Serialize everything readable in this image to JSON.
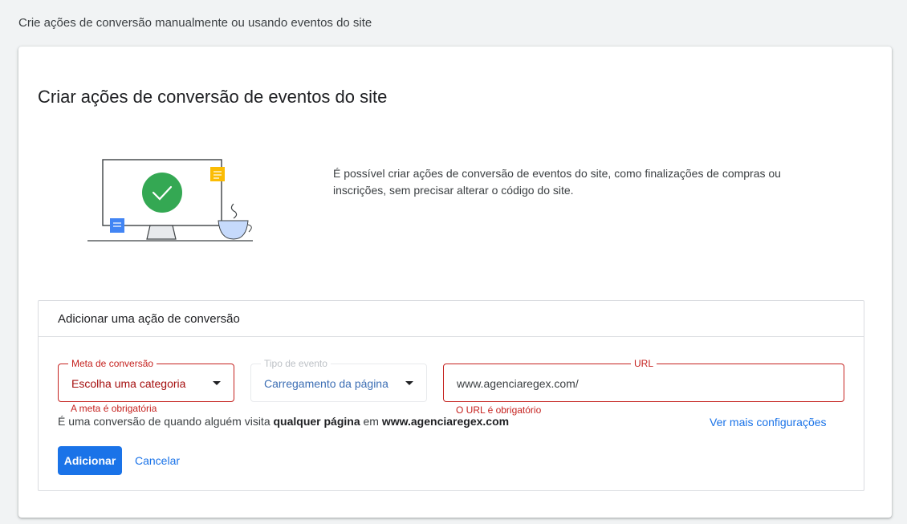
{
  "page": {
    "header": "Crie ações de conversão manualmente ou usando eventos do site"
  },
  "card": {
    "title": "Criar ações de conversão de eventos do site",
    "intro": "É possível criar ações de conversão de eventos do site, como finalizações de compras ou inscrições, sem precisar alterar o código do site.",
    "illustration_icon": "monitor-checkmark-illustration"
  },
  "add_panel": {
    "title": "Adicionar uma ação de conversão",
    "goal_field": {
      "label": "Meta de conversão",
      "value": "Escolha uma categoria",
      "error": "A meta é obrigatória"
    },
    "event_field": {
      "label": "Tipo de evento",
      "value": "Carregamento da página"
    },
    "url_field": {
      "label": "URL",
      "value": "www.agenciaregex.com/",
      "error": "O URL é obrigatório"
    },
    "summary": {
      "prefix": "É uma conversão de quando alguém visita ",
      "page": "qualquer página",
      "middle": " em ",
      "site": "www.agenciaregex.com"
    },
    "more_settings_label": "Ver mais configurações",
    "add_label": "Adicionar",
    "cancel_label": "Cancelar"
  },
  "colors": {
    "primary": "#1a73e8",
    "error": "#c5221f",
    "success": "#34a853"
  }
}
